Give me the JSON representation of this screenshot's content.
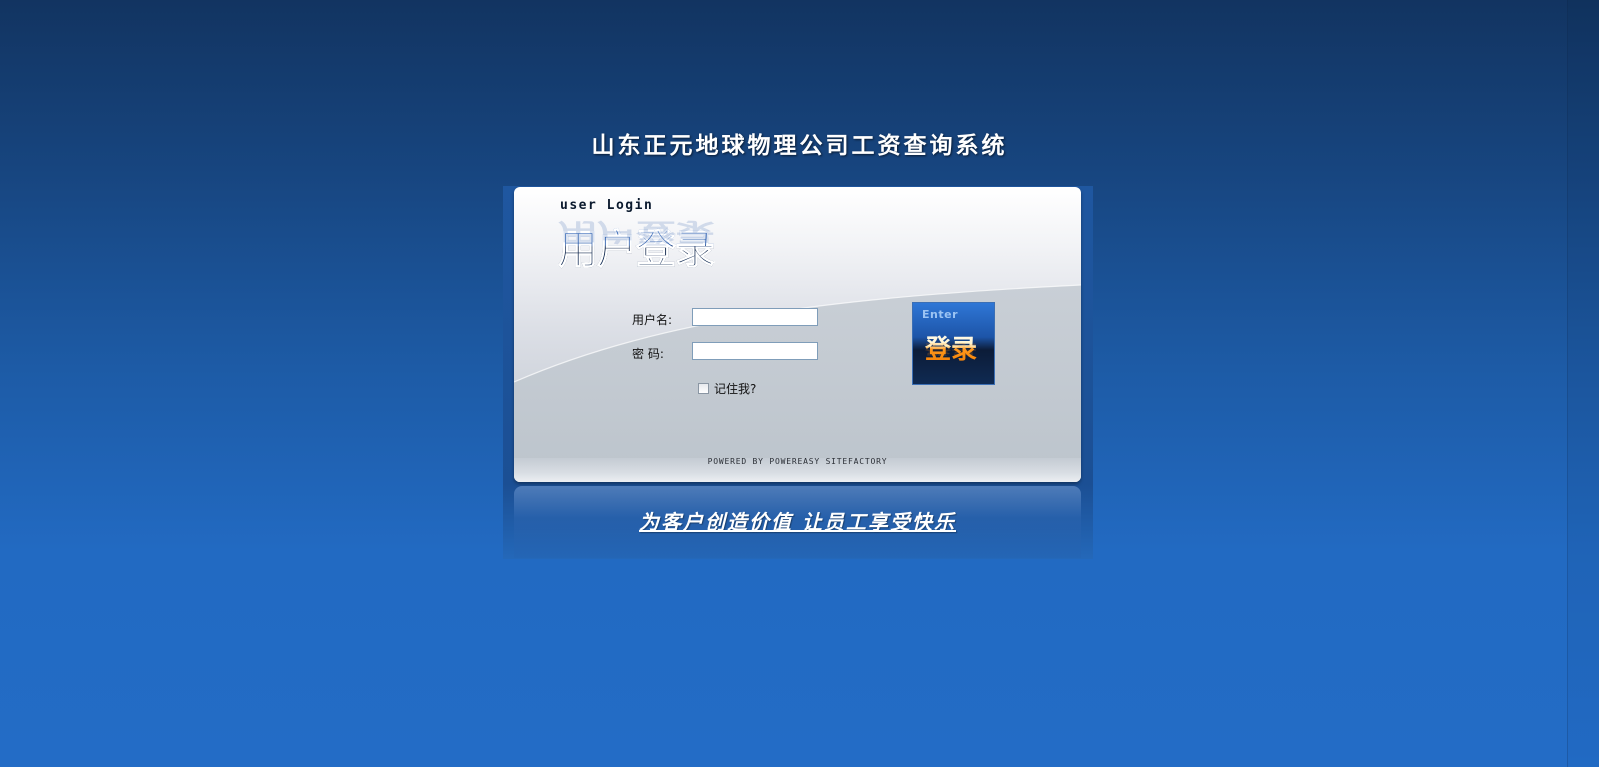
{
  "page": {
    "title": "山东正元地球物理公司工资查询系统",
    "slogan": "为客户创造价值   让员工享受快乐"
  },
  "login": {
    "heading_en": "user Login",
    "heading_cn": "用户登录",
    "username_label": "用户名:",
    "username_value": "",
    "password_label": "密 码:",
    "password_value": "",
    "remember_label": "记住我?",
    "remember_checked": false,
    "enter_en": "Enter",
    "enter_cn": "登录",
    "powered_by": "POWERED BY POWEREASY SITEFACTORY"
  },
  "colors": {
    "background_top": "#123461",
    "background_bottom": "#236cc6",
    "enter_accent": "#ff9a1e",
    "panel": "#dcdfe6"
  }
}
